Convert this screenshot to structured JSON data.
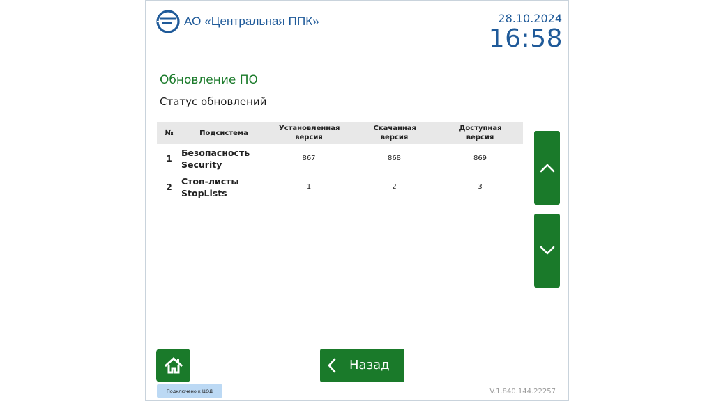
{
  "header": {
    "company": "АО «Центральная ППК»",
    "date": "28.10.2024",
    "time": "16:58"
  },
  "page": {
    "title": "Обновление ПО",
    "section": "Статус обновлений"
  },
  "table": {
    "columns": [
      "№",
      "Подсистема",
      "Установленная версия",
      "Скачанная версия",
      "Доступная версия"
    ],
    "rows": [
      {
        "num": "1",
        "name_ru": "Безопасность",
        "name_en": "Security",
        "installed": "867",
        "downloaded": "868",
        "available": "869"
      },
      {
        "num": "2",
        "name_ru": "Стоп-листы",
        "name_en": "StopLists",
        "installed": "1",
        "downloaded": "2",
        "available": "3"
      }
    ]
  },
  "controls": {
    "scroll_up_icon": "chevron-up-icon",
    "scroll_down_icon": "chevron-down-icon",
    "home_icon": "home-icon",
    "back_icon": "chevron-left-icon",
    "back_label": "Назад"
  },
  "footer": {
    "connection_status": "Подключено к ЦОД",
    "version": "V.1.840.144.22257"
  },
  "colors": {
    "primary_green": "#1a7a2a",
    "brand_blue": "#1f5a99",
    "status_badge_bg": "#bcd9f4",
    "table_header_bg": "#e8e8e8"
  }
}
